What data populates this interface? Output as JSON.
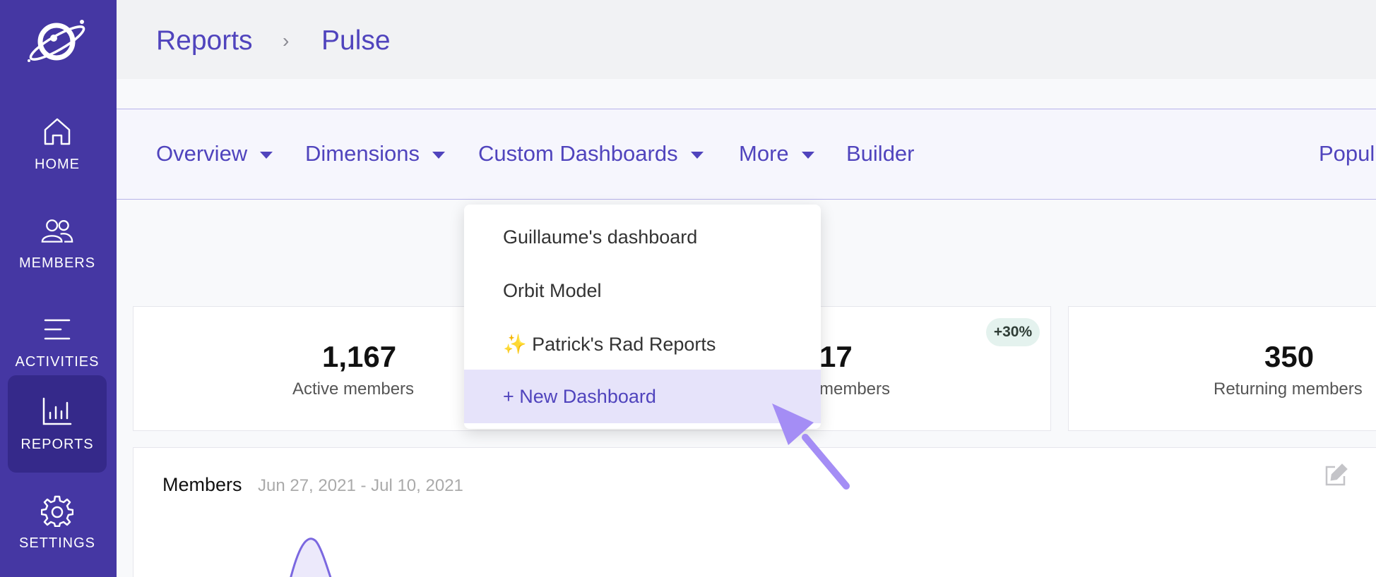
{
  "sidebar": {
    "items": [
      {
        "label": "HOME",
        "icon": "home-icon"
      },
      {
        "label": "MEMBERS",
        "icon": "members-icon"
      },
      {
        "label": "ACTIVITIES",
        "icon": "activities-icon"
      },
      {
        "label": "REPORTS",
        "icon": "reports-icon",
        "active": true
      },
      {
        "label": "SETTINGS",
        "icon": "gear-icon"
      }
    ]
  },
  "breadcrumb": {
    "parent": "Reports",
    "current": "Pulse",
    "separator": "›"
  },
  "tabs": {
    "overview": "Overview",
    "dimensions": "Dimensions",
    "custom_dashboards": "Custom Dashboards",
    "more": "More",
    "builder": "Builder",
    "right_cut": "Popul"
  },
  "dropdown": {
    "items": [
      "Guillaume's dashboard",
      "Orbit Model",
      "✨ Patrick's Rad Reports",
      "+ New Dashboard"
    ]
  },
  "stats": [
    {
      "value": "1,167",
      "label": "Active members"
    },
    {
      "value": "17",
      "label": "members",
      "badge": "+30%"
    },
    {
      "value": "350",
      "label": "Returning members"
    }
  ],
  "chart": {
    "title": "Members",
    "date_range": "Jun 27, 2021 - Jul 10, 2021"
  },
  "colors": {
    "sidebar": "#4537a3",
    "sidebar_active": "#35298a",
    "accent": "#5044bd",
    "highlight": "#e6e3fa",
    "arrow": "#a48df5"
  }
}
